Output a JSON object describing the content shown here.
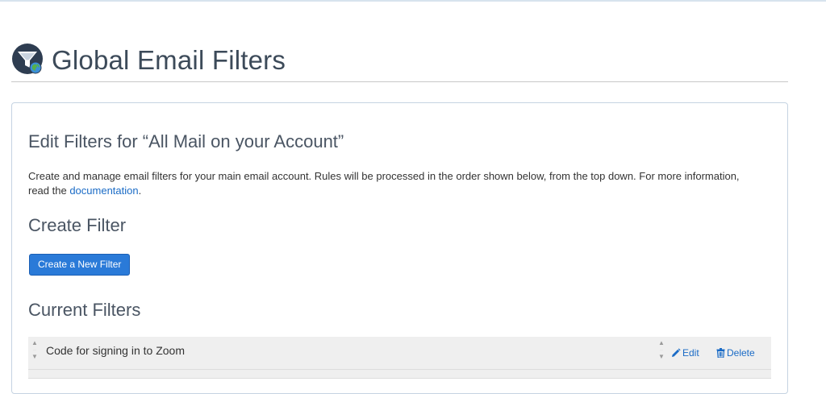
{
  "header": {
    "title": "Global Email Filters",
    "icon": "email-filter-icon"
  },
  "panel": {
    "edit_title": "Edit Filters for “All Mail on your Account”",
    "intro_text": "Create and manage email filters for your main email account. Rules will be processed in the order shown below, from the top down. For more information, read the ",
    "intro_link": "documentation",
    "intro_end": ".",
    "create_section_title": "Create Filter",
    "create_button_label": "Create a New Filter",
    "current_section_title": "Current Filters"
  },
  "filters": [
    {
      "name": "Code for signing in to Zoom",
      "edit_label": "Edit",
      "delete_label": "Delete"
    }
  ],
  "colors": {
    "accent": "#2a7ad8",
    "link": "#1a6bc6",
    "row_background": "#efefef"
  }
}
